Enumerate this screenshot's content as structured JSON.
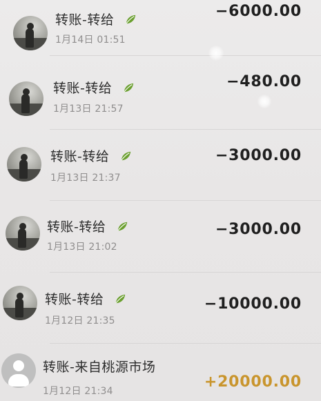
{
  "transactions": [
    {
      "title": "转账-转给",
      "time": "1月14日 01:51",
      "amount": "−6000.00",
      "type": "expense",
      "avatar": "photo-avatar",
      "badge_icon": "leaf-icon"
    },
    {
      "title": "转账-转给",
      "time": "1月13日 21:57",
      "amount": "−480.00",
      "type": "expense",
      "avatar": "photo-avatar",
      "badge_icon": "leaf-icon"
    },
    {
      "title": "转账-转给",
      "time": "1月13日 21:37",
      "amount": "−3000.00",
      "type": "expense",
      "avatar": "photo-avatar",
      "badge_icon": "leaf-icon"
    },
    {
      "title": "转账-转给",
      "time": "1月13日 21:02",
      "amount": "−3000.00",
      "type": "expense",
      "avatar": "photo-avatar",
      "badge_icon": "leaf-icon"
    },
    {
      "title": "转账-转给",
      "time": "1月12日 21:35",
      "amount": "−10000.00",
      "type": "expense",
      "avatar": "photo-avatar",
      "badge_icon": "leaf-icon"
    },
    {
      "title": "转账-来自桃源市场",
      "time": "1月12日 21:34",
      "amount": "+20000.00",
      "type": "income",
      "avatar": "default-avatar",
      "badge_icon": ""
    }
  ],
  "colors": {
    "background": "#e9e7e8",
    "expense_amount": "#1f1f1f",
    "income_amount": "#c9952d",
    "secondary_text": "#8f8d8d",
    "leaf_green": "#6a9f2e"
  }
}
